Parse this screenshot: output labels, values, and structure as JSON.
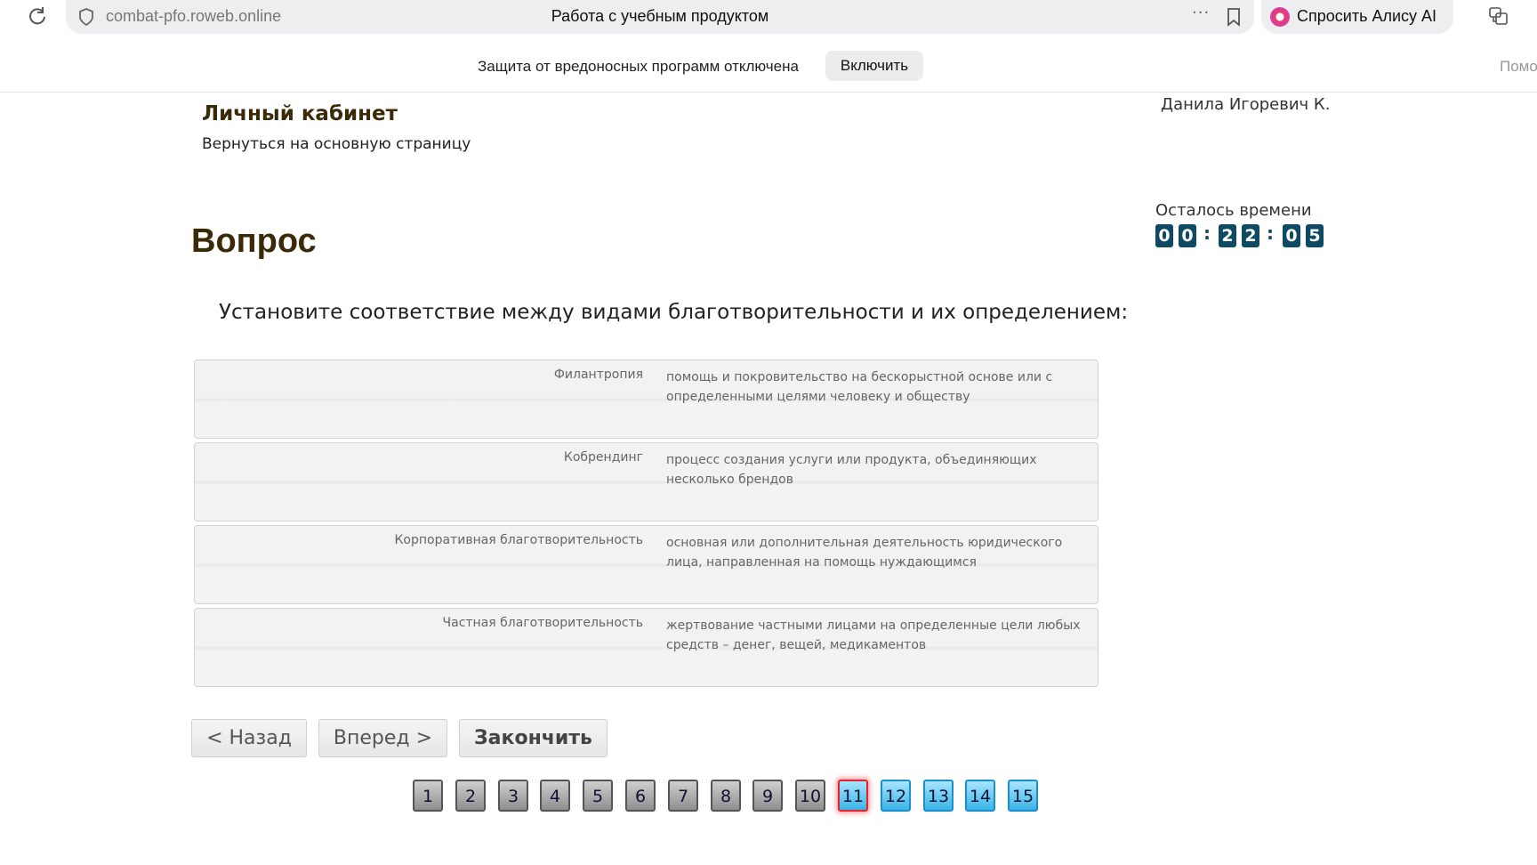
{
  "browser": {
    "url": "combat-pfo.roweb.online",
    "page_title": "Работа с учебным продуктом",
    "ask_alice_label": "Спросить Алису AI"
  },
  "banner": {
    "message": "Защита от вредоносных программ отключена",
    "enable_label": "Включить",
    "help_label": "Помо"
  },
  "header": {
    "cabinet_title": "Личный кабинет",
    "back_link": "Вернуться на основную страницу",
    "user_name": "Данила Игоревич К."
  },
  "timer": {
    "label": "Осталось времени",
    "digits": [
      "0",
      "0",
      "2",
      "2",
      "0",
      "5"
    ]
  },
  "question": {
    "heading": "Вопрос",
    "text": "Установите соответствие между видами благотворительности и их определением:",
    "pairs": [
      {
        "term": "Филантропия",
        "definition": "помощь и покровительство на бескорыстной основе или с определенными целями человеку и обществу"
      },
      {
        "term": "Кобрендинг",
        "definition": "процесс создания услуги или продукта, объединяющих несколько брендов"
      },
      {
        "term": "Корпоративная благотворительность",
        "definition": "основная или дополнительная деятельность юридического лица, направленная на помощь нуждающимся"
      },
      {
        "term": "Частная благотворительность",
        "definition": "жертвование частными лицами на определенные цели любых средств – денег, вещей, медикаментов"
      }
    ]
  },
  "nav": {
    "back_label": "< Назад",
    "forward_label": "Вперед >",
    "finish_label": "Закончить"
  },
  "pager": {
    "pages": [
      "1",
      "2",
      "3",
      "4",
      "5",
      "6",
      "7",
      "8",
      "9",
      "10",
      "11",
      "12",
      "13",
      "14",
      "15"
    ],
    "answered_count": 10,
    "current": "11"
  }
}
